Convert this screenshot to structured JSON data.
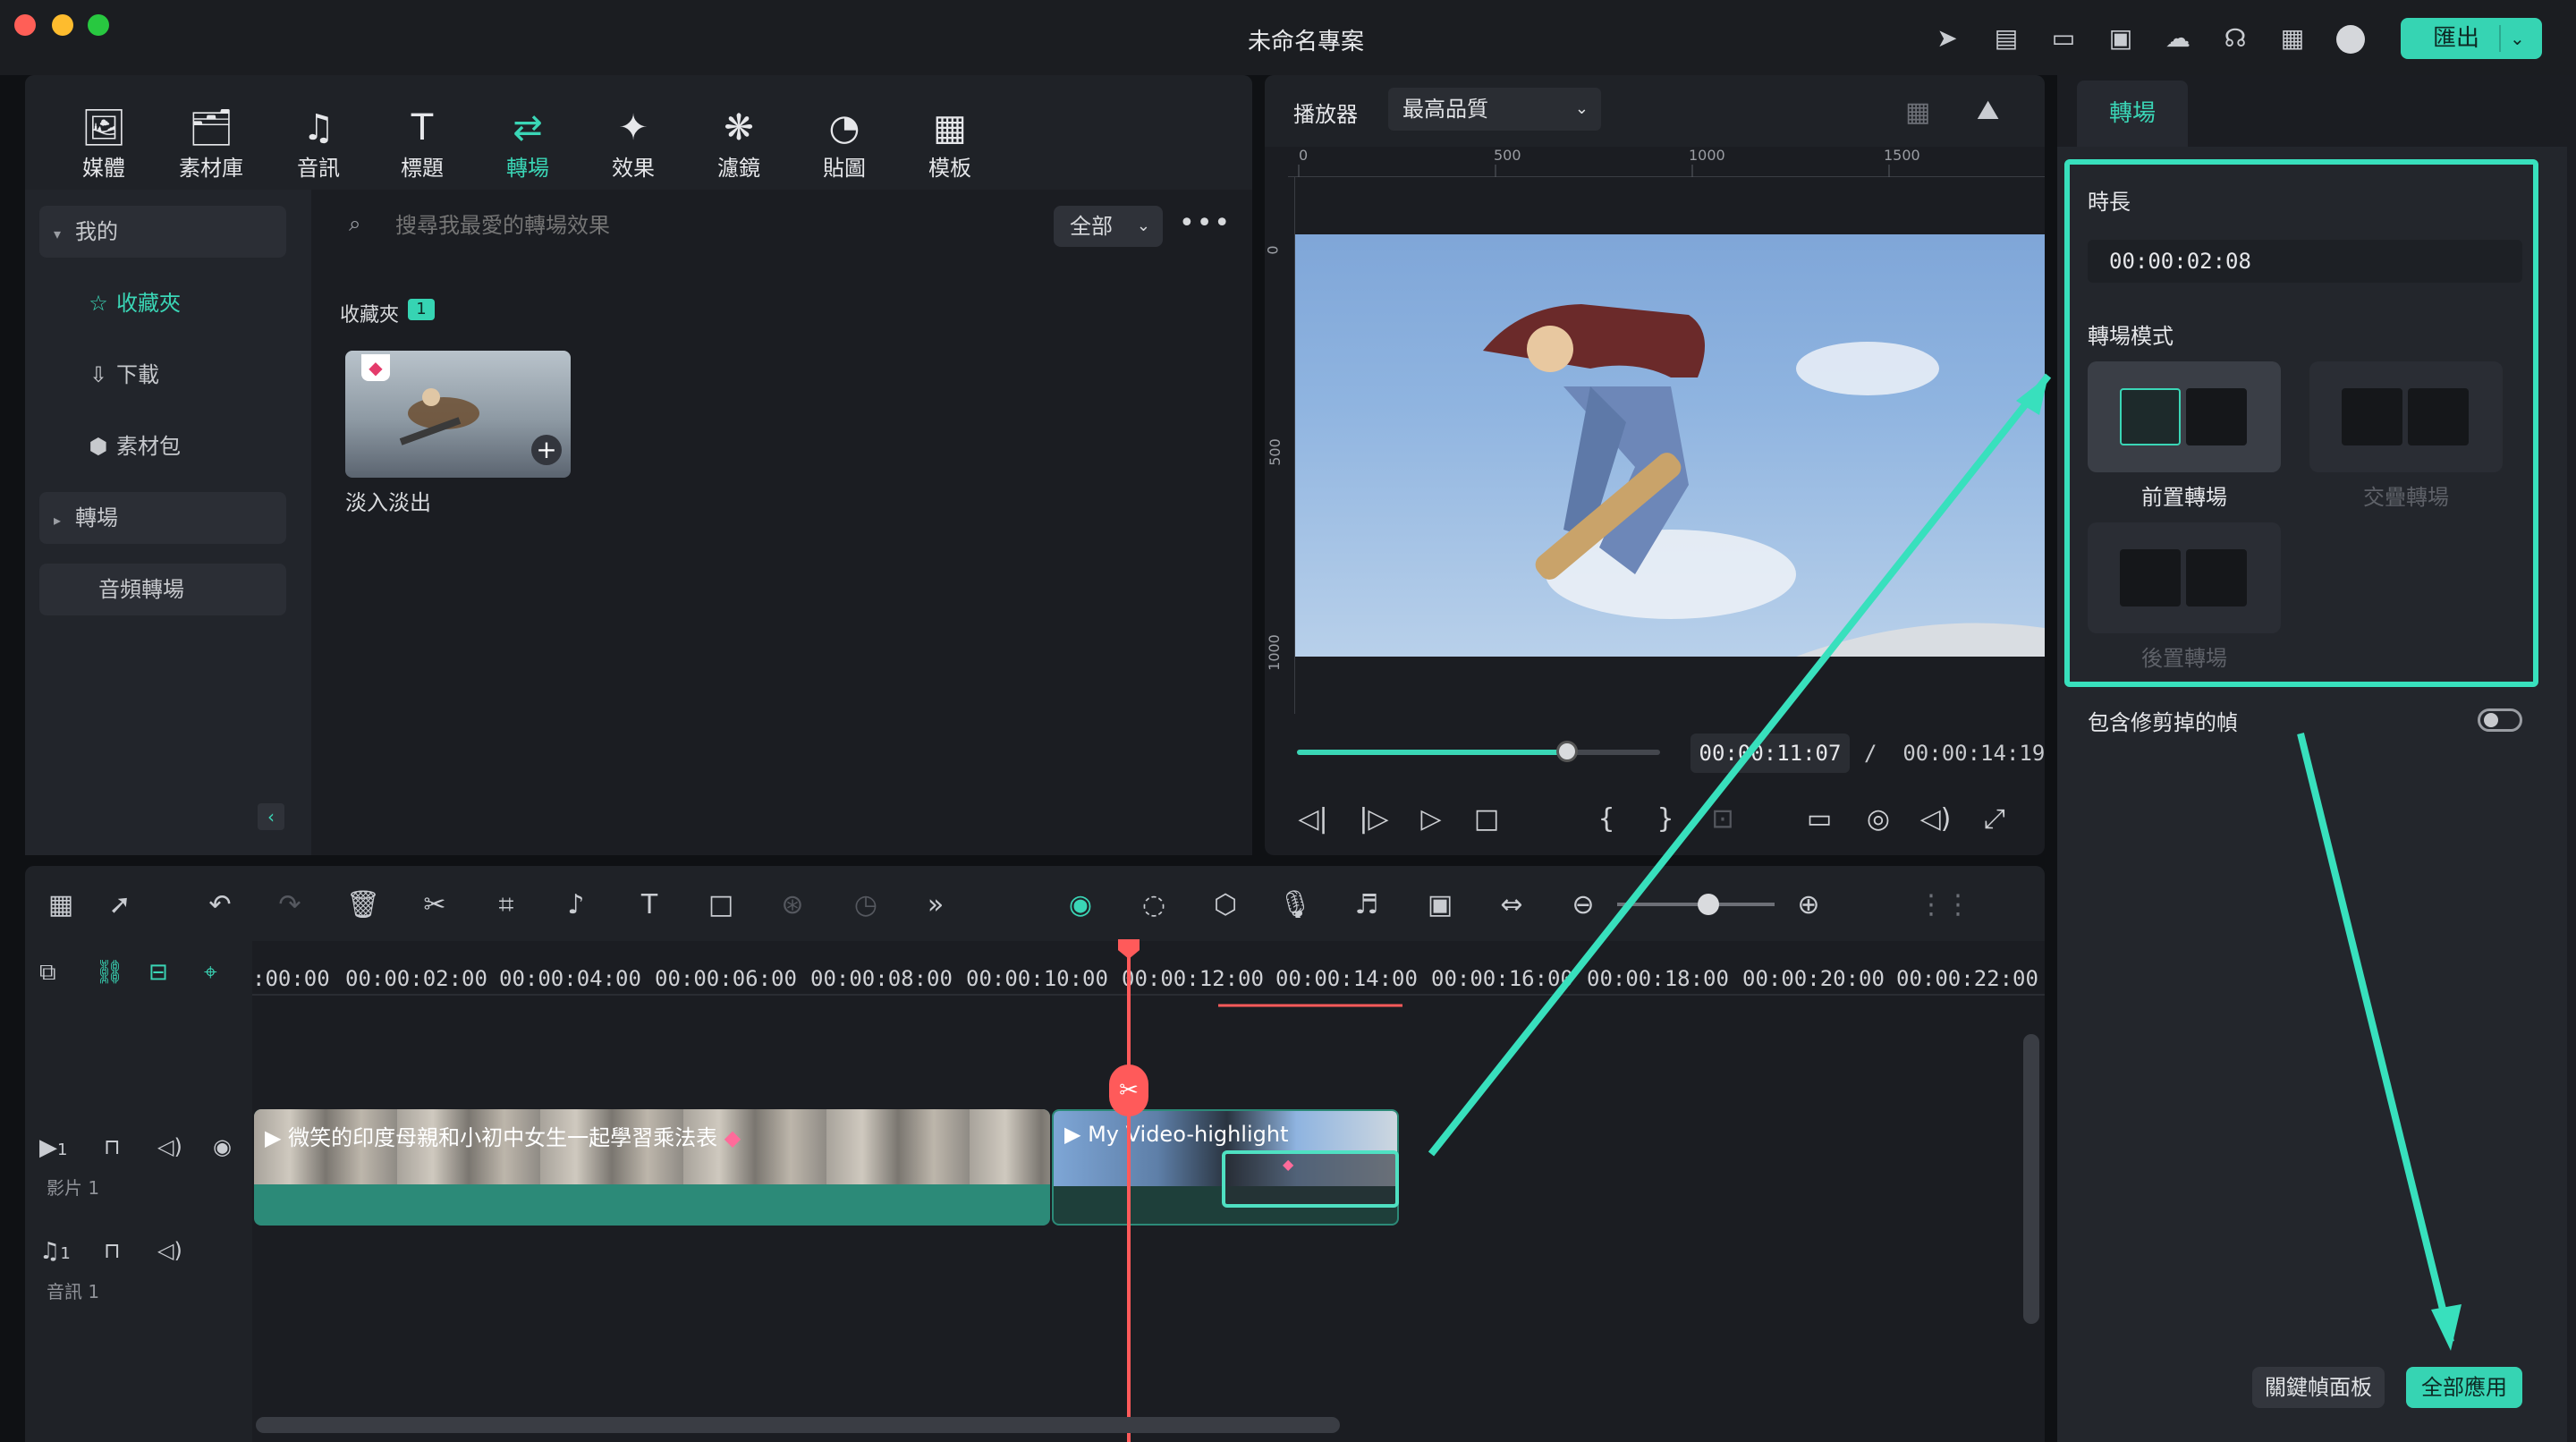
{
  "window": {
    "title": "未命名專案",
    "export_label": "匯出"
  },
  "media_tabs": [
    {
      "icon": "media-icon",
      "label": "媒體"
    },
    {
      "icon": "library-icon",
      "label": "素材庫"
    },
    {
      "icon": "audio-icon",
      "label": "音訊"
    },
    {
      "icon": "title-icon",
      "label": "標題"
    },
    {
      "icon": "transition-icon",
      "label": "轉場",
      "active": true
    },
    {
      "icon": "effects-icon",
      "label": "效果"
    },
    {
      "icon": "filters-icon",
      "label": "濾鏡"
    },
    {
      "icon": "stickers-icon",
      "label": "貼圖"
    },
    {
      "icon": "templates-icon",
      "label": "模板"
    }
  ],
  "sidebar": {
    "mine": "我的",
    "favorites": "收藏夾",
    "downloads": "下載",
    "packs": "素材包",
    "transitions": "轉場",
    "audio_transitions": "音頻轉場"
  },
  "search": {
    "placeholder": "搜尋我最愛的轉場效果",
    "filter": "全部"
  },
  "favorites_section": {
    "heading": "收藏夾",
    "count": "1",
    "item_label": "淡入淡出"
  },
  "player": {
    "label": "播放器",
    "quality": "最高品質",
    "ruler_h": [
      "0",
      "500",
      "1000",
      "1500"
    ],
    "ruler_v": [
      "0",
      "500",
      "1000"
    ],
    "current_time": "00:00:11:07",
    "separator": "/",
    "total_time": "00:00:14:19",
    "progress": 0.74
  },
  "right_panel": {
    "tab": "轉場",
    "duration_label": "時長",
    "duration_value": "00:00:02:08",
    "mode_label": "轉場模式",
    "modes": [
      "前置轉場",
      "交疊轉場",
      "後置轉場"
    ],
    "include_trimmed_label": "包含修剪掉的幀",
    "keyframe_btn": "關鍵幀面板",
    "apply_all_btn": "全部應用"
  },
  "timeline": {
    "ticks": [
      ":00:00",
      "00:00:02:00",
      "00:00:04:00",
      "00:00:06:00",
      "00:00:08:00",
      "00:00:10:00",
      "00:00:12:00",
      "00:00:14:00",
      "00:00:16:00",
      "00:00:18:00",
      "00:00:20:00",
      "00:00:22:00"
    ],
    "video_track": {
      "num": "1",
      "name": "影片 1"
    },
    "audio_track": {
      "num": "1",
      "name": "音訊 1"
    },
    "clip1_label": "微笑的印度母親和小初中女生一起學習乘法表",
    "clip2_label": "My Video-highlight",
    "zoom_level": 0.5
  },
  "colors": {
    "accent": "#36d4b3",
    "highlight_box": "#38e0bd",
    "playhead": "#ff5a5a",
    "clip": "#2c8a78"
  }
}
